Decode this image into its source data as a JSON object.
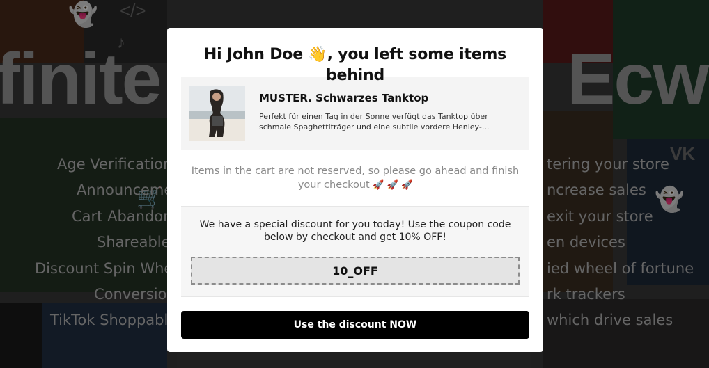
{
  "background": {
    "hero_left": "finite",
    "hero_right": "Ecw",
    "left_lines": [
      "Age Verification",
      "Announceme",
      "Cart Abandon",
      "Shareable",
      "Discount Spin Whee",
      "Conversion",
      "TikTok Shoppable"
    ],
    "right_lines": [
      "tering your store",
      "ncrease sales",
      "exit your store",
      "en devices",
      "ied wheel of fortune",
      "rk trackers",
      "which drive sales"
    ],
    "colors": {
      "overlay": "rgba(0,0,0,0.45)"
    }
  },
  "modal": {
    "title": "Hi John Doe 👋, you left some items behind",
    "product": {
      "image_icon": "product-photo",
      "name": "MUSTER. Schwarzes Tanktop",
      "description_line1": "Perfekt für einen Tag in der Sonne verfügt das Tanktop über",
      "description_line2": "schmale Spaghettiträger und eine subtile vordere Henley-..."
    },
    "reserve_note": "Items in the cart are not reserved, so please go ahead and finish your checkout",
    "rockets": "🚀 🚀 🚀",
    "discount_text": "We have a special discount for you today! Use the coupon code below by checkout and get 10% OFF!",
    "coupon_code": "10_OFF",
    "cta_label": "Use the discount NOW",
    "colors": {
      "cta_bg": "#000000",
      "cta_text": "#ffffff",
      "product_bg": "#f4f4f4",
      "coupon_bg": "#e4e4e4"
    }
  }
}
